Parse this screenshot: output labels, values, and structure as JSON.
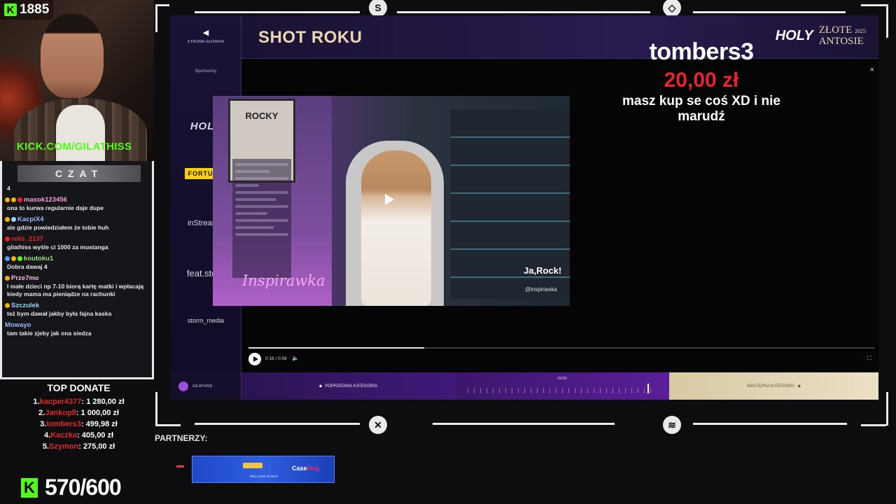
{
  "stream": {
    "viewer_count": "1885",
    "kick_url": "KICK.COM/GILATHISS",
    "chat_title": "CZAT",
    "goal": "570/600"
  },
  "chat": {
    "top_number": "4",
    "messages": [
      {
        "user": "masok123456",
        "color": "#f5a1d8",
        "text": "ona to kurwa regularnie daje dupe"
      },
      {
        "user": "KacpiX4",
        "color": "#9bb8ff",
        "text": "ale gdzie powiedziałem że tobie huh"
      },
      {
        "user": "relis_2137",
        "color": "#e3262a",
        "text": "gilathiss wyśle ci 1000 za mustanga"
      },
      {
        "user": "koutoku1",
        "color": "#9be37a",
        "text": "Dobra dawaj 4"
      },
      {
        "user": "Prze7mo",
        "color": "#ffb3e8",
        "text": "I małe dzieci np 7-10 biorą kartę matki i wpłacają kiedy mama ma pieniądze na rachunki"
      },
      {
        "user": "Szczulek",
        "color": "#9bd7ff",
        "text": "też bym dawał jakby była fajna kaska"
      },
      {
        "user": "Mowayo",
        "color": "#9bb8ff",
        "text": "tam takie zjeby jak ona siedza"
      }
    ]
  },
  "top_donate": {
    "title": "TOP DONATE",
    "entries": [
      {
        "rank": "1.",
        "name": "kacper4377",
        "amount": ": 1 280,00 zł"
      },
      {
        "rank": "2.",
        "name": "Jankopll",
        "amount": ": 1 000,00 zł"
      },
      {
        "rank": "3.",
        "name": "tombers3",
        "amount": ": 499,98 zł"
      },
      {
        "rank": "4.",
        "name": "Kaczka",
        "amount": ": 405,00 zł"
      },
      {
        "rank": "5.",
        "name": "Szymon",
        "amount": ": 275,00 zł"
      }
    ]
  },
  "app": {
    "back_label": "STRONA GŁÓWNA",
    "sponsors_label": "Sponsorzy",
    "sponsors": [
      "HOLY",
      "FORTUNA",
      "inStreamly",
      "feat.store",
      "storm_media"
    ],
    "title": "SHOT ROKU",
    "brand_holy": "HOLY",
    "brand_line1": "ZŁOTE",
    "brand_line2": "ANTOSIE",
    "brand_year": "2025",
    "close": "×",
    "time": "0:16 / 0:58",
    "progress_fraction": 0.28,
    "user": "GILATHISS",
    "prev_label": "POPRZEDNIA KATEGORIA",
    "counter": "29/30",
    "next_label": "NASTĘPNA KATEGORIA"
  },
  "video": {
    "poster_text": "ROCKY",
    "neon_text": "Inspirawka",
    "watermark": "Ja,Rock!",
    "handle": "@inspirawka"
  },
  "donation": {
    "user": "tombers3",
    "amount": "20,00 zł",
    "message": "masz kup se coś XD i nie marudź"
  },
  "partners": {
    "label": "PARTNERZY:",
    "banner_bonus": "WELCOME BONUS",
    "banner_brand_a": "Case",
    "banner_brand_b": "Hug"
  }
}
